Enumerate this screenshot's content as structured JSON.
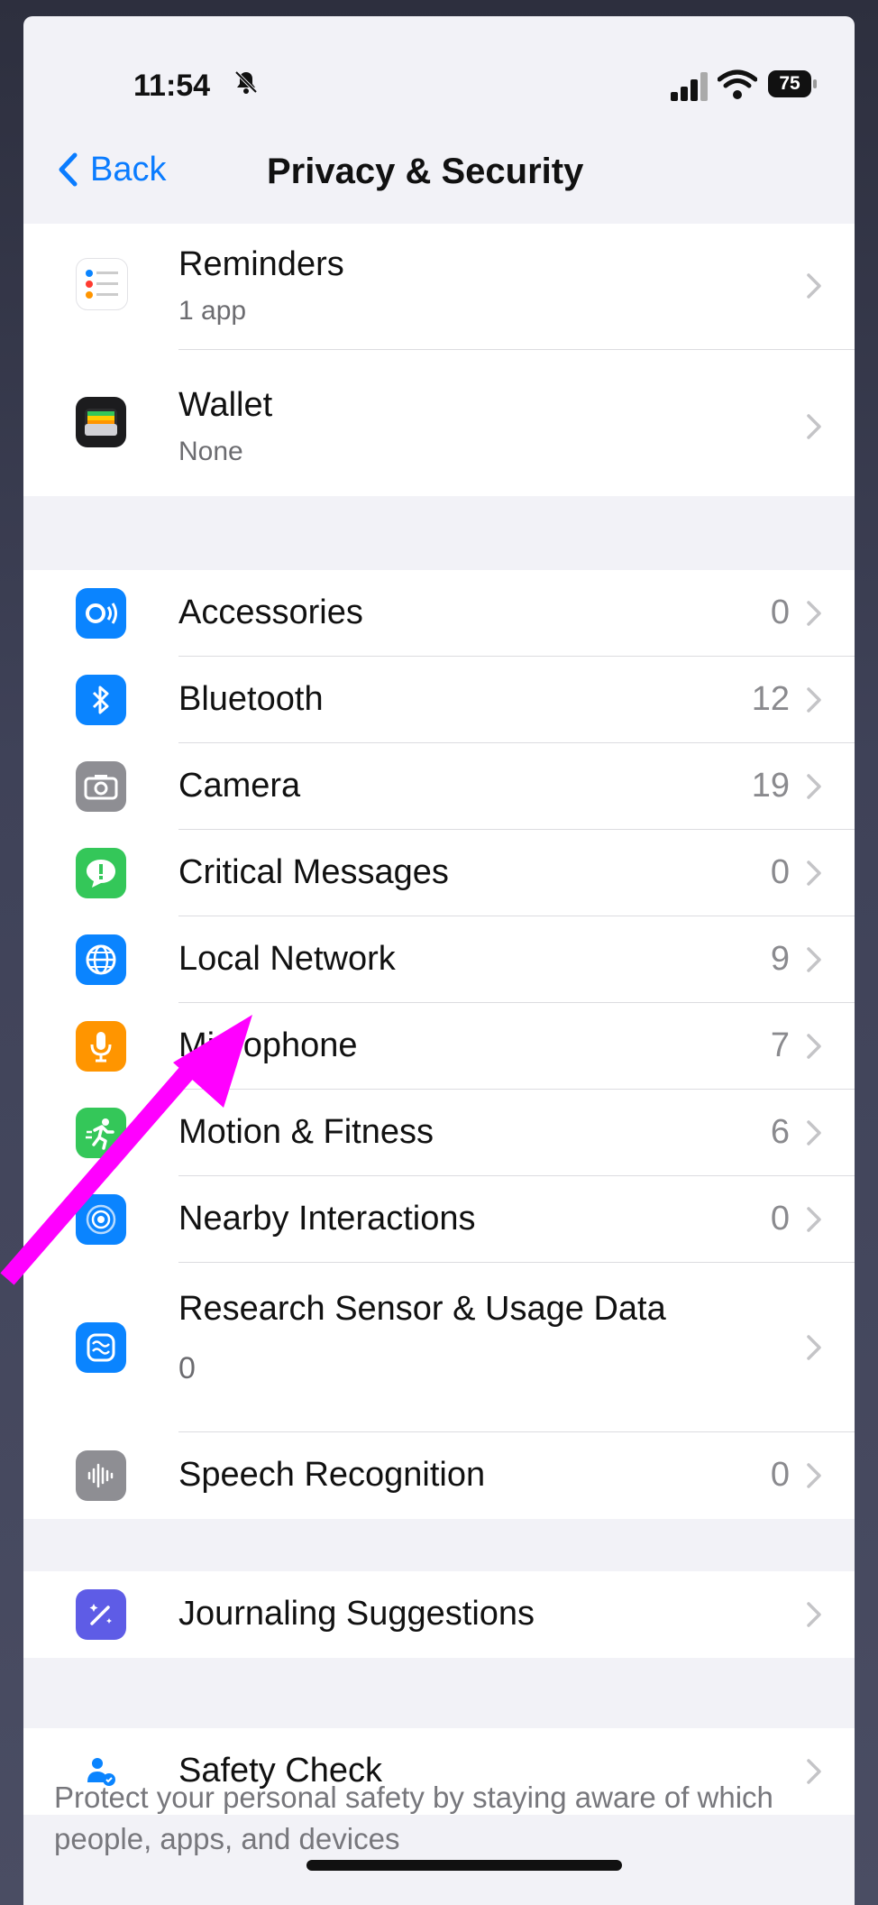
{
  "status": {
    "time": "11:54",
    "battery": "75",
    "silent_icon": "bell-slash-icon"
  },
  "nav": {
    "back_label": "Back",
    "title": "Privacy & Security"
  },
  "group1": [
    {
      "label": "Reminders",
      "sub": "1 app",
      "icon": "reminders-icon"
    },
    {
      "label": "Wallet",
      "sub": "None",
      "icon": "wallet-icon"
    }
  ],
  "group2": [
    {
      "label": "Accessories",
      "count": "0",
      "icon": "accessories-icon",
      "color": "#0a84ff"
    },
    {
      "label": "Bluetooth",
      "count": "12",
      "icon": "bluetooth-icon",
      "color": "#0a84ff"
    },
    {
      "label": "Camera",
      "count": "19",
      "icon": "camera-icon",
      "color": "#8e8e93"
    },
    {
      "label": "Critical Messages",
      "count": "0",
      "icon": "critical-message-icon",
      "color": "#34c759"
    },
    {
      "label": "Local Network",
      "count": "9",
      "icon": "globe-icon",
      "color": "#0a84ff"
    },
    {
      "label": "Microphone",
      "count": "7",
      "icon": "microphone-icon",
      "color": "#ff9500"
    },
    {
      "label": "Motion & Fitness",
      "count": "6",
      "icon": "running-figure-icon",
      "color": "#34c759"
    },
    {
      "label": "Nearby Interactions",
      "count": "0",
      "icon": "nearby-interactions-icon",
      "color": "#0a84ff"
    },
    {
      "label": "Research Sensor & Usage Data",
      "count": "0",
      "icon": "research-sensor-icon",
      "color": "#0a84ff"
    },
    {
      "label": "Speech Recognition",
      "count": "0",
      "icon": "waveform-icon",
      "color": "#8e8e93"
    }
  ],
  "group3": [
    {
      "label": "Journaling Suggestions",
      "icon": "journaling-icon",
      "color": "#5e5ce6"
    }
  ],
  "group4": [
    {
      "label": "Safety Check",
      "icon": "safety-check-icon",
      "color": "#0a84ff"
    }
  ],
  "footer": {
    "text": "Protect your personal safety by staying aware of which people, apps, and devices"
  },
  "annotation": {
    "arrow_color": "#ff00ff",
    "points_to": "Microphone"
  }
}
